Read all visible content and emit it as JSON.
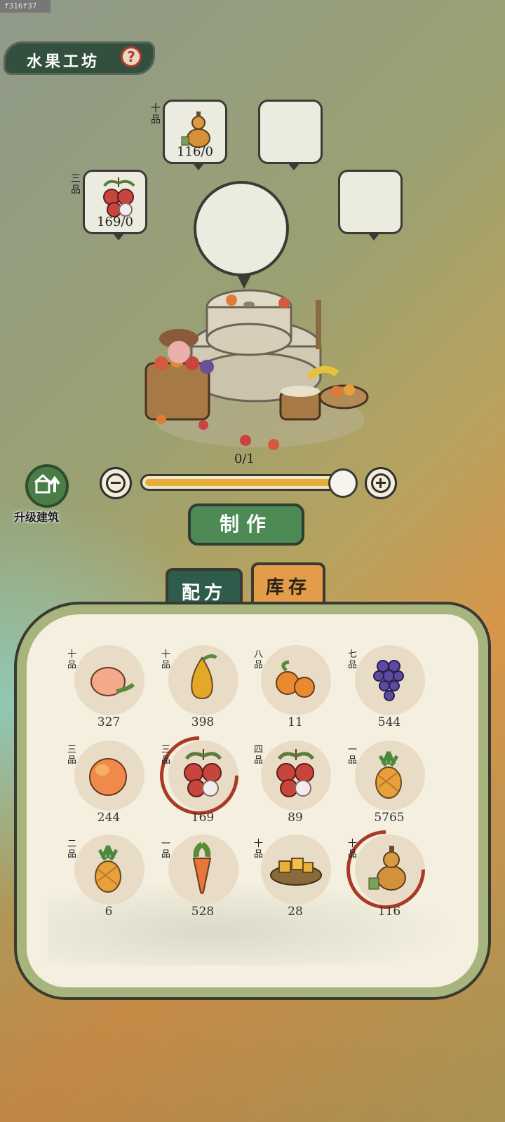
{
  "build_id": "f316f37",
  "header": {
    "title": "水果工坊",
    "help_glyph": "?"
  },
  "production_slots": [
    {
      "grade": "十品",
      "count": "116/0",
      "icon": "gourd-icon"
    },
    {
      "grade": "",
      "count": "",
      "icon": ""
    },
    {
      "grade": "三品",
      "count": "169/0",
      "icon": "lychee-icon"
    },
    {
      "grade": "",
      "count": "",
      "icon": ""
    }
  ],
  "craft": {
    "progress_text": "0/1",
    "slider_fraction": 1.0,
    "make_label": "制作"
  },
  "upgrade": {
    "label": "升级建筑"
  },
  "tabs": {
    "recipe": "配方",
    "stock": "库存",
    "active": "recipe"
  },
  "items": [
    {
      "grade": "十品",
      "qty": "327",
      "icon": "peach-icon",
      "selected": false
    },
    {
      "grade": "十品",
      "qty": "398",
      "icon": "pear-icon",
      "selected": false
    },
    {
      "grade": "八品",
      "qty": "11",
      "icon": "orange-icon",
      "selected": false
    },
    {
      "grade": "七品",
      "qty": "544",
      "icon": "grape-icon",
      "selected": false
    },
    {
      "grade": "三品",
      "qty": "244",
      "icon": "mango-icon",
      "selected": false
    },
    {
      "grade": "三品",
      "qty": "169",
      "icon": "lychee-icon",
      "selected": true
    },
    {
      "grade": "四品",
      "qty": "89",
      "icon": "lychee-icon",
      "selected": false
    },
    {
      "grade": "一品",
      "qty": "5765",
      "icon": "pineapple-icon",
      "selected": false
    },
    {
      "grade": "二品",
      "qty": "6",
      "icon": "pineapple-icon",
      "selected": false
    },
    {
      "grade": "一品",
      "qty": "528",
      "icon": "carrot-icon",
      "selected": false
    },
    {
      "grade": "十品",
      "qty": "28",
      "icon": "dried-fruit-basket-icon",
      "selected": false
    },
    {
      "grade": "十品",
      "qty": "116",
      "icon": "gourd-icon",
      "selected": true
    }
  ],
  "colors": {
    "accent_green": "#4d8a55",
    "tab_active": "#2f5c4a",
    "tab_inactive": "#e39c4a",
    "slider_fill": "#e6ad3a",
    "selection_ring": "#a83a26"
  }
}
